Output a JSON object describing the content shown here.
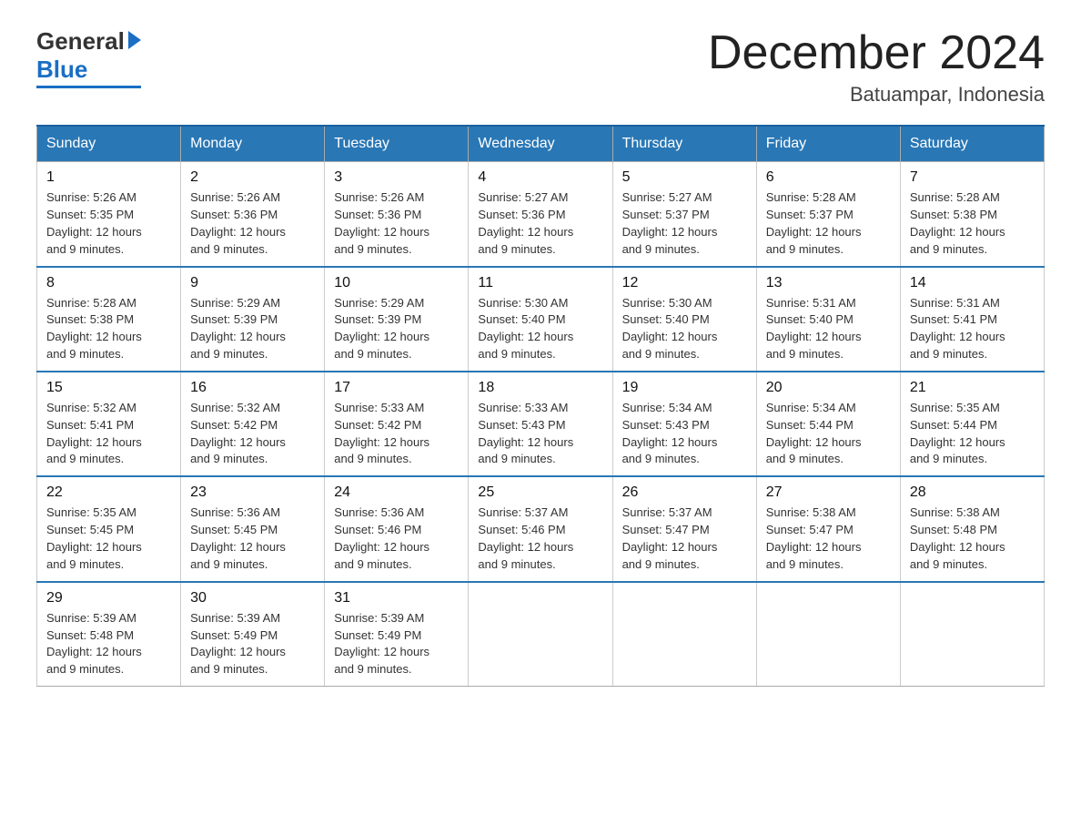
{
  "logo": {
    "general": "General",
    "blue": "Blue",
    "url_text": "GeneralBlue"
  },
  "title": "December 2024",
  "subtitle": "Batuampar, Indonesia",
  "days": [
    "Sunday",
    "Monday",
    "Tuesday",
    "Wednesday",
    "Thursday",
    "Friday",
    "Saturday"
  ],
  "weeks": [
    [
      {
        "day": "1",
        "sunrise": "5:26 AM",
        "sunset": "5:35 PM",
        "daylight": "12 hours and 9 minutes."
      },
      {
        "day": "2",
        "sunrise": "5:26 AM",
        "sunset": "5:36 PM",
        "daylight": "12 hours and 9 minutes."
      },
      {
        "day": "3",
        "sunrise": "5:26 AM",
        "sunset": "5:36 PM",
        "daylight": "12 hours and 9 minutes."
      },
      {
        "day": "4",
        "sunrise": "5:27 AM",
        "sunset": "5:36 PM",
        "daylight": "12 hours and 9 minutes."
      },
      {
        "day": "5",
        "sunrise": "5:27 AM",
        "sunset": "5:37 PM",
        "daylight": "12 hours and 9 minutes."
      },
      {
        "day": "6",
        "sunrise": "5:28 AM",
        "sunset": "5:37 PM",
        "daylight": "12 hours and 9 minutes."
      },
      {
        "day": "7",
        "sunrise": "5:28 AM",
        "sunset": "5:38 PM",
        "daylight": "12 hours and 9 minutes."
      }
    ],
    [
      {
        "day": "8",
        "sunrise": "5:28 AM",
        "sunset": "5:38 PM",
        "daylight": "12 hours and 9 minutes."
      },
      {
        "day": "9",
        "sunrise": "5:29 AM",
        "sunset": "5:39 PM",
        "daylight": "12 hours and 9 minutes."
      },
      {
        "day": "10",
        "sunrise": "5:29 AM",
        "sunset": "5:39 PM",
        "daylight": "12 hours and 9 minutes."
      },
      {
        "day": "11",
        "sunrise": "5:30 AM",
        "sunset": "5:40 PM",
        "daylight": "12 hours and 9 minutes."
      },
      {
        "day": "12",
        "sunrise": "5:30 AM",
        "sunset": "5:40 PM",
        "daylight": "12 hours and 9 minutes."
      },
      {
        "day": "13",
        "sunrise": "5:31 AM",
        "sunset": "5:40 PM",
        "daylight": "12 hours and 9 minutes."
      },
      {
        "day": "14",
        "sunrise": "5:31 AM",
        "sunset": "5:41 PM",
        "daylight": "12 hours and 9 minutes."
      }
    ],
    [
      {
        "day": "15",
        "sunrise": "5:32 AM",
        "sunset": "5:41 PM",
        "daylight": "12 hours and 9 minutes."
      },
      {
        "day": "16",
        "sunrise": "5:32 AM",
        "sunset": "5:42 PM",
        "daylight": "12 hours and 9 minutes."
      },
      {
        "day": "17",
        "sunrise": "5:33 AM",
        "sunset": "5:42 PM",
        "daylight": "12 hours and 9 minutes."
      },
      {
        "day": "18",
        "sunrise": "5:33 AM",
        "sunset": "5:43 PM",
        "daylight": "12 hours and 9 minutes."
      },
      {
        "day": "19",
        "sunrise": "5:34 AM",
        "sunset": "5:43 PM",
        "daylight": "12 hours and 9 minutes."
      },
      {
        "day": "20",
        "sunrise": "5:34 AM",
        "sunset": "5:44 PM",
        "daylight": "12 hours and 9 minutes."
      },
      {
        "day": "21",
        "sunrise": "5:35 AM",
        "sunset": "5:44 PM",
        "daylight": "12 hours and 9 minutes."
      }
    ],
    [
      {
        "day": "22",
        "sunrise": "5:35 AM",
        "sunset": "5:45 PM",
        "daylight": "12 hours and 9 minutes."
      },
      {
        "day": "23",
        "sunrise": "5:36 AM",
        "sunset": "5:45 PM",
        "daylight": "12 hours and 9 minutes."
      },
      {
        "day": "24",
        "sunrise": "5:36 AM",
        "sunset": "5:46 PM",
        "daylight": "12 hours and 9 minutes."
      },
      {
        "day": "25",
        "sunrise": "5:37 AM",
        "sunset": "5:46 PM",
        "daylight": "12 hours and 9 minutes."
      },
      {
        "day": "26",
        "sunrise": "5:37 AM",
        "sunset": "5:47 PM",
        "daylight": "12 hours and 9 minutes."
      },
      {
        "day": "27",
        "sunrise": "5:38 AM",
        "sunset": "5:47 PM",
        "daylight": "12 hours and 9 minutes."
      },
      {
        "day": "28",
        "sunrise": "5:38 AM",
        "sunset": "5:48 PM",
        "daylight": "12 hours and 9 minutes."
      }
    ],
    [
      {
        "day": "29",
        "sunrise": "5:39 AM",
        "sunset": "5:48 PM",
        "daylight": "12 hours and 9 minutes."
      },
      {
        "day": "30",
        "sunrise": "5:39 AM",
        "sunset": "5:49 PM",
        "daylight": "12 hours and 9 minutes."
      },
      {
        "day": "31",
        "sunrise": "5:39 AM",
        "sunset": "5:49 PM",
        "daylight": "12 hours and 9 minutes."
      },
      null,
      null,
      null,
      null
    ]
  ],
  "labels": {
    "sunrise": "Sunrise:",
    "sunset": "Sunset:",
    "daylight": "Daylight:"
  },
  "accent_color": "#2977b5"
}
